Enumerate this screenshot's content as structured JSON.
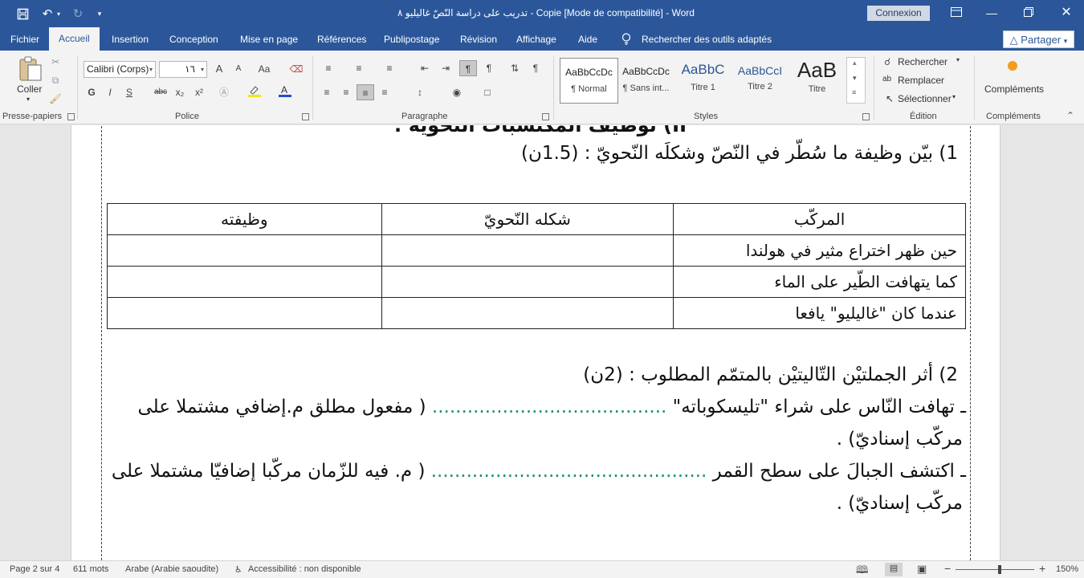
{
  "colors": {
    "accent": "#2b579a",
    "ribbon": "#f3f3f3",
    "dots": "#1f8f5f"
  },
  "titlebar": {
    "title": "تدريب على دراسة النّصّ غاليليو ٨ - Copie [Mode de compatibilité] - Word",
    "connexion": "Connexion",
    "icons": [
      "save-icon",
      "undo-icon",
      "redo-icon",
      "customize-icon",
      "ribbon-display-icon",
      "minimize-icon",
      "restore-icon",
      "close-icon"
    ]
  },
  "tabs": [
    "Fichier",
    "Accueil",
    "Insertion",
    "Conception",
    "Mise en page",
    "Références",
    "Publipostage",
    "Révision",
    "Affichage",
    "Aide"
  ],
  "search": "Rechercher des outils adaptés",
  "partager": "Partager",
  "ribbon": {
    "clipboard": {
      "paste": "Coller",
      "label": "Presse-papiers"
    },
    "font": {
      "name": "Calibri (Corps)",
      "size": "١٦",
      "label": "Police",
      "bold": "G",
      "italic": "I",
      "underline": "S",
      "strike": "abc",
      "sub": "x₂",
      "sup": "x²",
      "grow": "A",
      "shrink": "A",
      "case": "Aa"
    },
    "paragraph": {
      "label": "Paragraphe"
    },
    "styles": {
      "label": "Styles",
      "items": [
        {
          "sample": "AaBbCcDc",
          "name": "¶ Normal"
        },
        {
          "sample": "AaBbCcDc",
          "name": "¶ Sans int..."
        },
        {
          "sample": "AaBbC",
          "name": "Titre 1"
        },
        {
          "sample": "AaBbCcI",
          "name": "Titre 2"
        },
        {
          "sample": "AaB",
          "name": "Titre"
        }
      ]
    },
    "editing": {
      "label": "Édition",
      "find": "Rechercher",
      "replace": "Remplacer",
      "select": "Sélectionner"
    },
    "addins": {
      "label": "Compléments",
      "button": "Compléments"
    }
  },
  "document": {
    "heading_cut": "II) توظيف المكتسبات النّحويّة :",
    "q1": "1) بيّن وظيفة ما سُطّر في النّصّ وشكلَه النّحويّ : (1.5ن)",
    "table": {
      "headers": [
        "المركّب",
        "شكله النّحويّ",
        "وظيفته"
      ],
      "rows": [
        [
          "حين ظهر اختراع مثير في هولندا",
          "",
          ""
        ],
        [
          "كما يتهافت الطّير على الماء",
          "",
          ""
        ],
        [
          "عندما كان \"غاليليو\" يافعا",
          "",
          ""
        ]
      ]
    },
    "q2": "2) أثر الجملتيْن التّاليتيْن بالمتمّم المطلوب : (2ن)",
    "s1_text": "ـ تهافت النّاس على شراء \"تليسكوباته\"",
    "s1_dots": "........................................",
    "s1_hint": "( مفعول مطلق م.إضافي مشتملا على",
    "s1_cont": "مركّب إسناديّ) .",
    "s2_text": "ـ اكتشف الجبالَ على سطح القمر",
    "s2_dots": "...............................................",
    "s2_hint": "( م. فيه للزّمان مركّبا إضافيّا مشتملا على",
    "s2_cont": "مركّب إسناديّ) ."
  },
  "status": {
    "page": "Page 2 sur 4",
    "words": "611 mots",
    "language": "Arabe (Arabie saoudite)",
    "accessibility": "Accessibilité : non disponible",
    "zoom": "150%",
    "zoom_minus": "−",
    "zoom_plus": "+",
    "zoom_level": 150
  }
}
